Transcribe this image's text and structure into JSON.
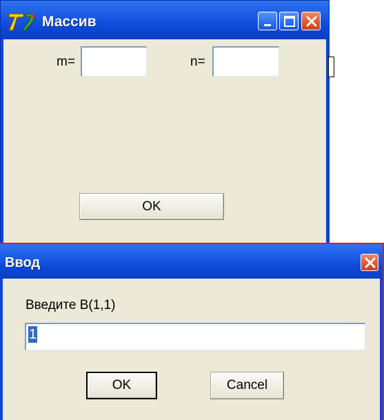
{
  "array_window": {
    "title": "Массив",
    "m_label": "m=",
    "m_value": "",
    "n_label": "n=",
    "n_value": "",
    "ok_label": "OK"
  },
  "input_dialog": {
    "title": "Ввод",
    "prompt": "Введите B(1,1)",
    "value": "1",
    "ok_label": "OK",
    "cancel_label": "Cancel"
  },
  "colors": {
    "titlebar_blue": "#0a46d8",
    "client_beige": "#ece9d8",
    "close_red": "#e3572f",
    "selection_blue": "#316ac5"
  }
}
